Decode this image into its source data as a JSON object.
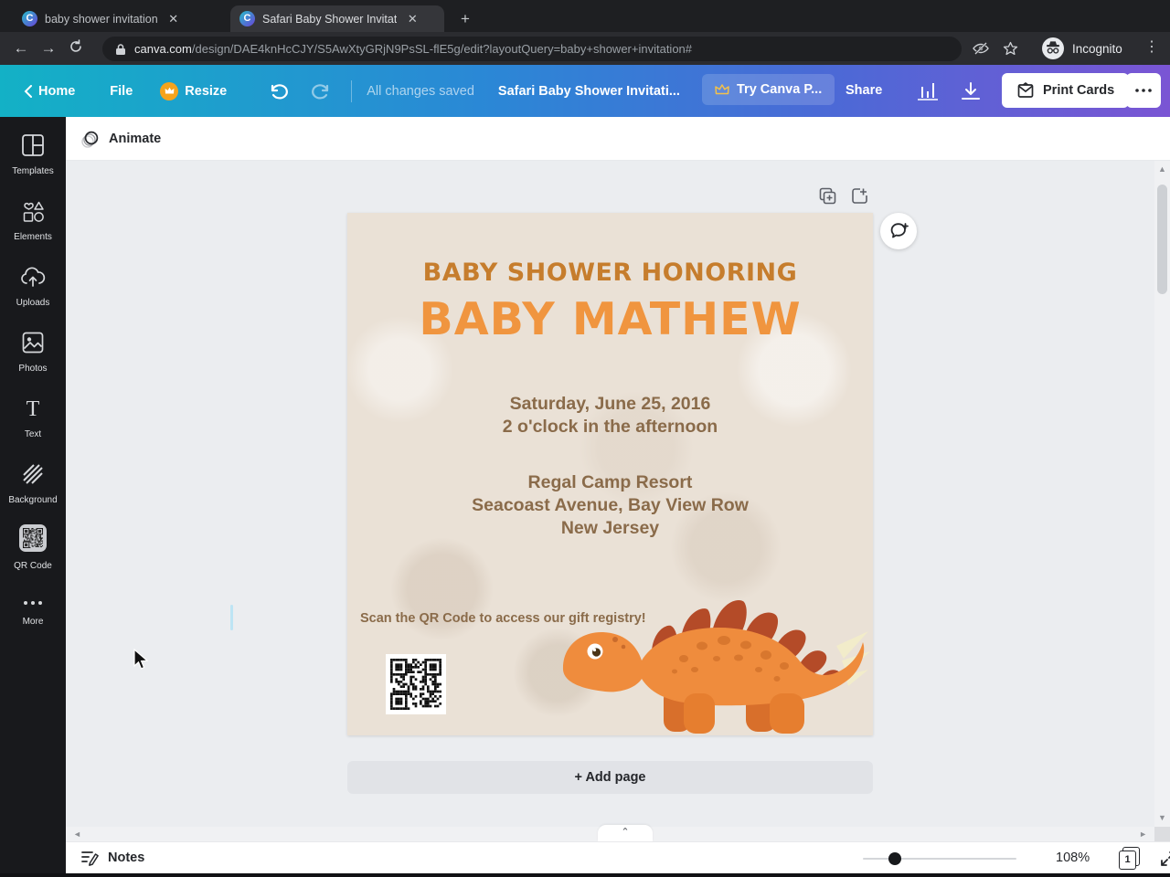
{
  "browser": {
    "tabs": [
      {
        "title": "baby shower invitation"
      },
      {
        "title": "Safari Baby Shower Invitat"
      }
    ],
    "url_host": "canva.com",
    "url_path": "/design/DAE4knHcCJY/S5AwXtyGRjN9PsSL-flE5g/edit?layoutQuery=baby+shower+invitation#",
    "incognito_label": "Incognito"
  },
  "header": {
    "home": "Home",
    "file": "File",
    "resize": "Resize",
    "saved": "All changes saved",
    "doc_title": "Safari Baby Shower Invitati...",
    "try_pro": "Try Canva P...",
    "share": "Share",
    "print": "Print Cards"
  },
  "sidebar": {
    "items": [
      {
        "label": "Templates"
      },
      {
        "label": "Elements"
      },
      {
        "label": "Uploads"
      },
      {
        "label": "Photos"
      },
      {
        "label": "Text"
      },
      {
        "label": "Background"
      },
      {
        "label": "QR Code"
      },
      {
        "label": "More"
      }
    ]
  },
  "canvas": {
    "animate": "Animate",
    "add_page": "+ Add page",
    "invitation": {
      "eyebrow": "BABY SHOWER HONORING",
      "title": "BABY MATHEW",
      "date": "Saturday, June 25, 2016",
      "time": "2 o'clock in the afternoon",
      "venue": "Regal Camp Resort",
      "address": "Seacoast Avenue, Bay View Row",
      "state": "New Jersey",
      "qr_note": "Scan the QR Code to access our gift registry!"
    }
  },
  "footer": {
    "notes": "Notes",
    "zoom": "108%",
    "page": "1",
    "help": "?"
  },
  "colors": {
    "header_gradient_left": "#13b1c6",
    "header_gradient_mid": "#2b87d6",
    "header_gradient_right": "#7a55d4",
    "page_bg": "#eae1d6",
    "eyebrow_orange": "#c67d2d",
    "title_orange": "#f0953f",
    "body_brown": "#8a6b4a",
    "dino_body": "#ef8c3d",
    "dino_plates": "#b44b28",
    "dino_spikes": "#f2ecca"
  }
}
